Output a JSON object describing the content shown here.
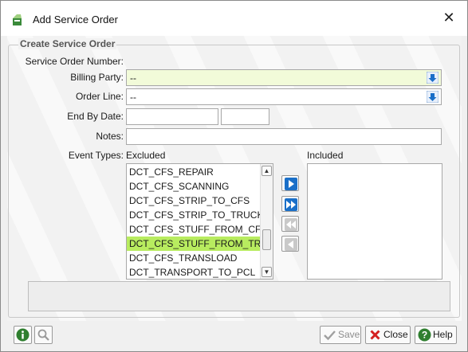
{
  "window": {
    "title": "Add Service Order",
    "close_glyph": "✕"
  },
  "group": {
    "legend": "Create Service Order"
  },
  "form": {
    "service_order_number_label": "Service Order Number:",
    "billing_party_label": "Billing Party:",
    "billing_party_value": "--",
    "order_line_label": "Order Line:",
    "order_line_value": "--",
    "end_by_date_label": "End By Date:",
    "end_by_date_value": "",
    "end_by_time_value": "",
    "notes_label": "Notes:",
    "notes_value": "",
    "event_types_label": "Event Types:",
    "excluded_label": "Excluded",
    "included_label": "Included"
  },
  "excluded_items": [
    "DCT_CFS_REPAIR",
    "DCT_CFS_SCANNING",
    "DCT_CFS_STRIP_TO_CFS",
    "DCT_CFS_STRIP_TO_TRUCK",
    "DCT_CFS_STUFF_FROM_CFS",
    "DCT_CFS_STUFF_FROM_TRUCK",
    "DCT_CFS_TRANSLOAD",
    "DCT_TRANSPORT_TO_PCL"
  ],
  "selected_excluded": "DCT_CFS_STUFF_FROM_TRUCK",
  "included_items": [],
  "buttons": {
    "save": "Save",
    "close": "Close",
    "help": "Help"
  },
  "icons": {
    "app": "app-icon",
    "dropdown": "dropdown-arrow-icon",
    "move_right": "arrow-right-icon",
    "move_all_right": "double-arrow-right-icon",
    "move_all_left": "double-arrow-left-icon",
    "move_left": "arrow-left-icon",
    "info": "info-icon",
    "search": "search-icon",
    "save": "checkmark-icon",
    "close": "x-icon",
    "help": "question-icon"
  },
  "colors": {
    "selection": "#b8ec5f",
    "required_field": "#f2fbd9",
    "accent_blue": "#1a6fc8"
  }
}
